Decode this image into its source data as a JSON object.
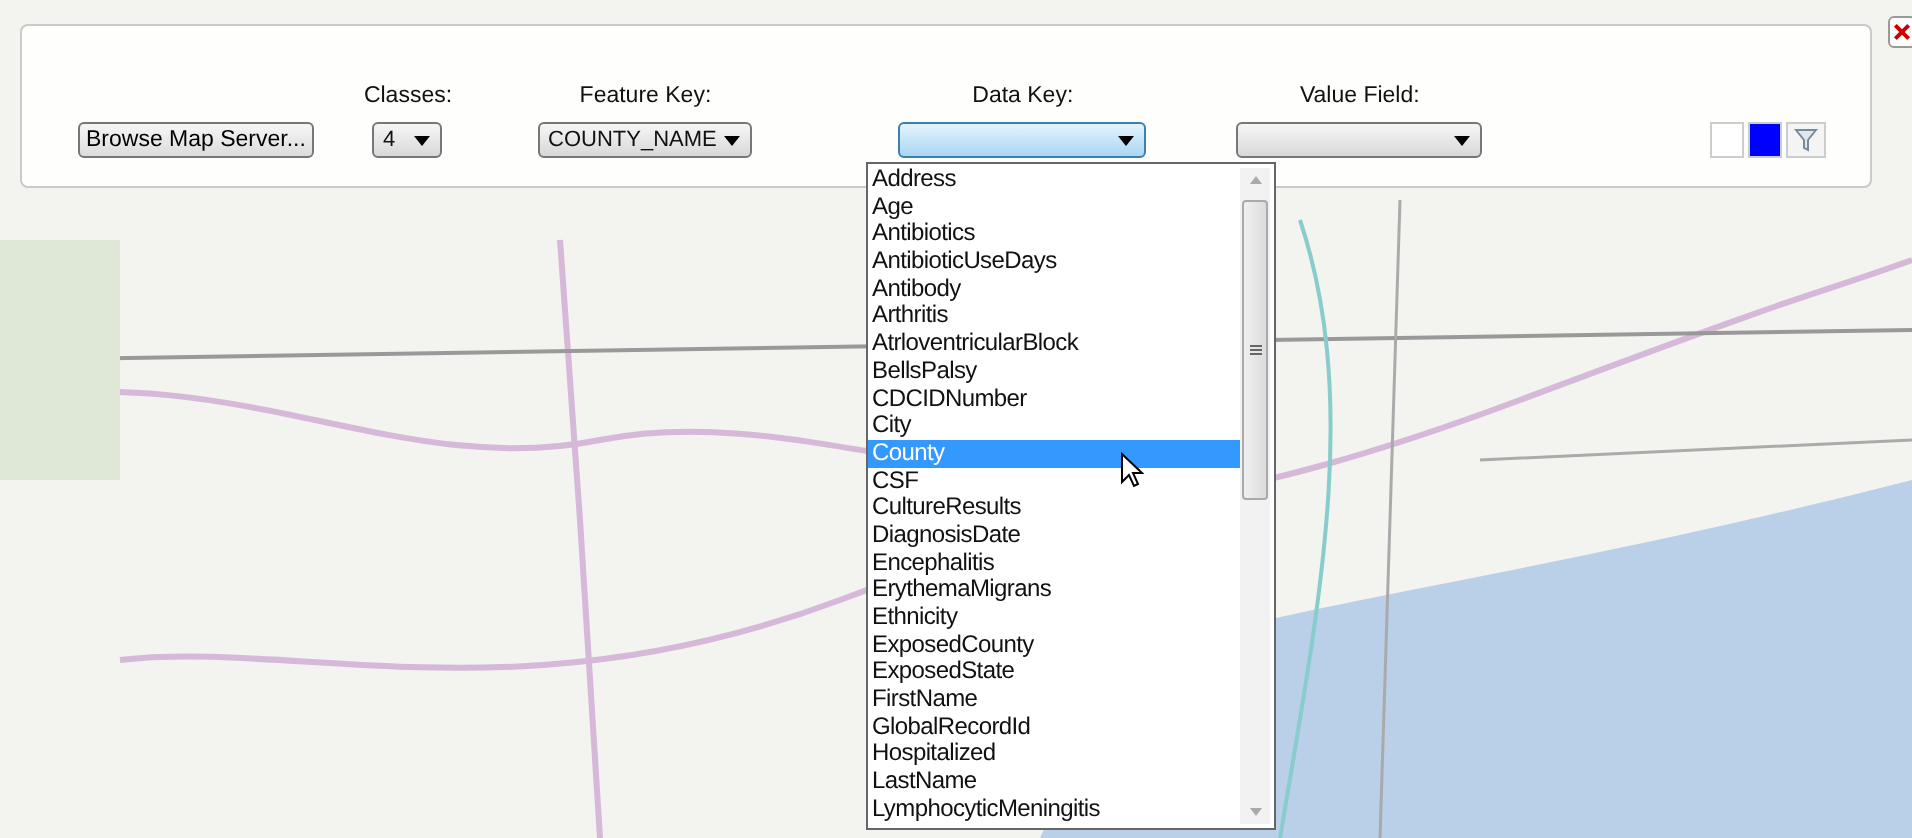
{
  "toolbar": {
    "browse_button": "Browse Map Server...",
    "fields": [
      {
        "label": "Classes:",
        "value": "4",
        "expanded": false
      },
      {
        "label": "Feature Key:",
        "value": "COUNTY_NAME",
        "expanded": false
      },
      {
        "label": "Data Key:",
        "expanded": true
      },
      {
        "label": "Value Field:",
        "expanded": false
      }
    ],
    "swatches": [
      {
        "color": "#ffffff"
      },
      {
        "color": "#0000ff"
      }
    ]
  },
  "dropdown": {
    "items": [
      {
        "label": "Address",
        "selected": false
      },
      {
        "label": "Age",
        "selected": false
      },
      {
        "label": "Antibiotics",
        "selected": false
      },
      {
        "label": "AntibioticUseDays",
        "selected": false
      },
      {
        "label": "Antibody",
        "selected": false
      },
      {
        "label": "Arthritis",
        "selected": false
      },
      {
        "label": "AtrloventricularBlock",
        "selected": false
      },
      {
        "label": "BellsPalsy",
        "selected": false
      },
      {
        "label": "CDCIDNumber",
        "selected": false
      },
      {
        "label": "City",
        "selected": false
      },
      {
        "label": "County",
        "selected": true
      },
      {
        "label": "CSF",
        "selected": false
      },
      {
        "label": "CultureResults",
        "selected": false
      },
      {
        "label": "DiagnosisDate",
        "selected": false
      },
      {
        "label": "Encephalitis",
        "selected": false
      },
      {
        "label": "ErythemaMigrans",
        "selected": false
      },
      {
        "label": "Ethnicity",
        "selected": false
      },
      {
        "label": "ExposedCounty",
        "selected": false
      },
      {
        "label": "ExposedState",
        "selected": false
      },
      {
        "label": "FirstName",
        "selected": false
      },
      {
        "label": "GlobalRecordId",
        "selected": false
      },
      {
        "label": "Hospitalized",
        "selected": false
      },
      {
        "label": "LastName",
        "selected": false
      },
      {
        "label": "LymphocyticMeningitis",
        "selected": false
      }
    ]
  }
}
